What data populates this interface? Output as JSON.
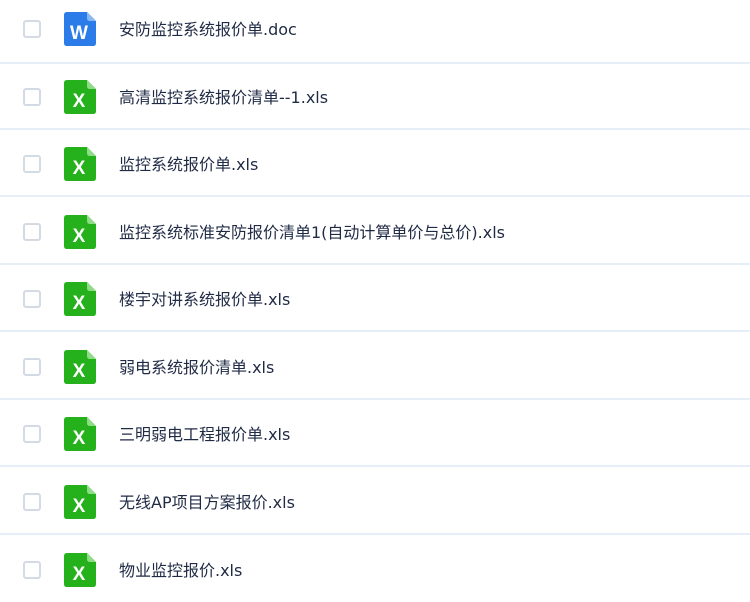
{
  "files": [
    {
      "name": "安防监控系统报价单.doc",
      "type": "word",
      "icon": "word-doc-icon",
      "icon_color": "#2b7ce9",
      "icon_letter": "W"
    },
    {
      "name": "高清监控系统报价清单--1.xls",
      "type": "excel",
      "icon": "excel-xls-icon",
      "icon_color": "#25b11b",
      "icon_letter": "X"
    },
    {
      "name": "监控系统报价单.xls",
      "type": "excel",
      "icon": "excel-xls-icon",
      "icon_color": "#25b11b",
      "icon_letter": "X"
    },
    {
      "name": "监控系统标准安防报价清单1(自动计算单价与总价).xls",
      "type": "excel",
      "icon": "excel-xls-icon",
      "icon_color": "#25b11b",
      "icon_letter": "X"
    },
    {
      "name": "楼宇对讲系统报价单.xls",
      "type": "excel",
      "icon": "excel-xls-icon",
      "icon_color": "#25b11b",
      "icon_letter": "X"
    },
    {
      "name": "弱电系统报价清单.xls",
      "type": "excel",
      "icon": "excel-xls-icon",
      "icon_color": "#25b11b",
      "icon_letter": "X"
    },
    {
      "name": "三明弱电工程报价单.xls",
      "type": "excel",
      "icon": "excel-xls-icon",
      "icon_color": "#25b11b",
      "icon_letter": "X"
    },
    {
      "name": "无线AP项目方案报价.xls",
      "type": "excel",
      "icon": "excel-xls-icon",
      "icon_color": "#25b11b",
      "icon_letter": "X"
    },
    {
      "name": "物业监控报价.xls",
      "type": "excel",
      "icon": "excel-xls-icon",
      "icon_color": "#25b11b",
      "icon_letter": "X"
    }
  ],
  "colors": {
    "row_divider": "#e6eff8",
    "checkbox_border": "#d3dae3",
    "text": "#1f2a44"
  }
}
